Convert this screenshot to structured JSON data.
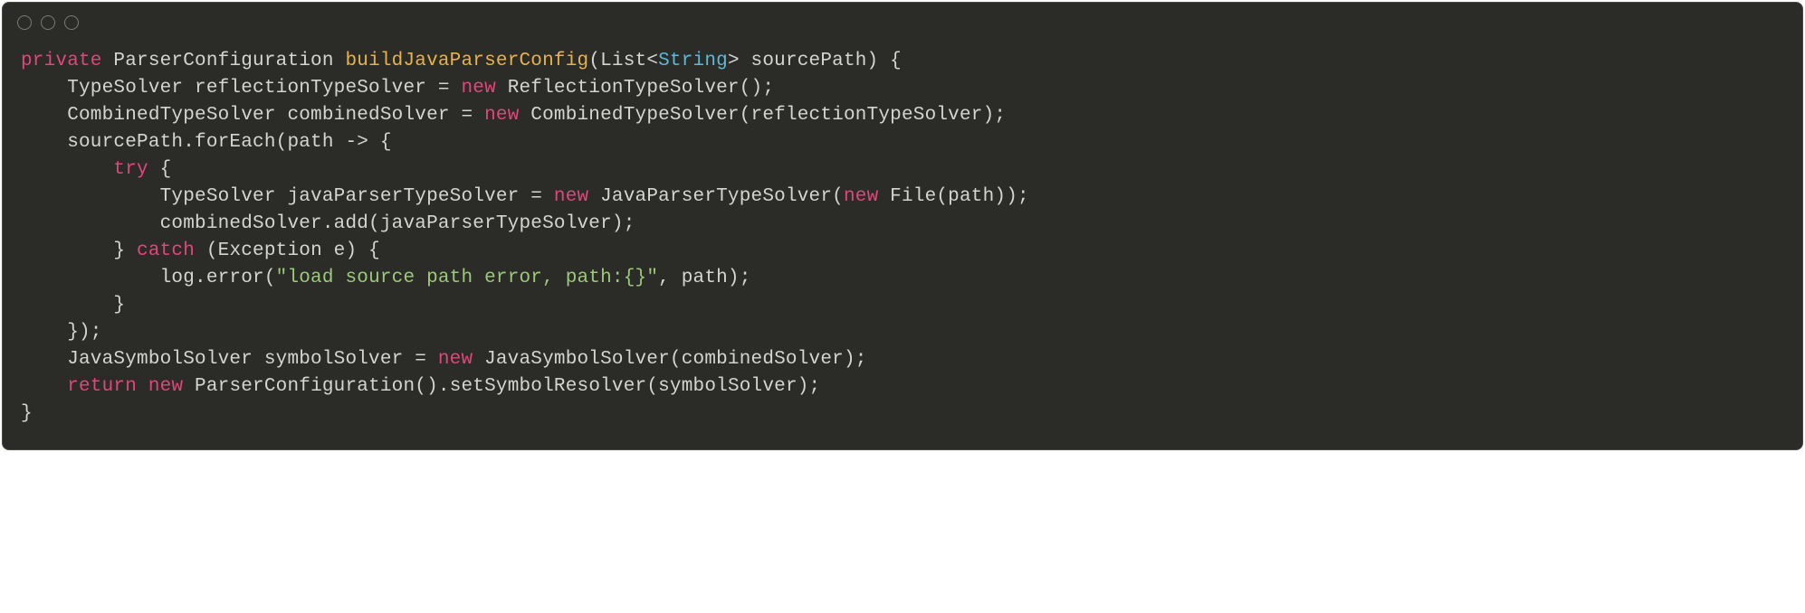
{
  "code": {
    "tokens": [
      [
        {
          "cls": "tok-keyword",
          "text": "private"
        },
        {
          "cls": "tok-plain",
          "text": " ParserConfiguration "
        },
        {
          "cls": "tok-method",
          "text": "buildJavaParserConfig"
        },
        {
          "cls": "tok-plain",
          "text": "(List<"
        },
        {
          "cls": "tok-builtin",
          "text": "String"
        },
        {
          "cls": "tok-plain",
          "text": "> sourcePath) {"
        }
      ],
      [
        {
          "cls": "tok-plain",
          "text": "    TypeSolver reflectionTypeSolver = "
        },
        {
          "cls": "tok-new",
          "text": "new"
        },
        {
          "cls": "tok-plain",
          "text": " ReflectionTypeSolver();"
        }
      ],
      [
        {
          "cls": "tok-plain",
          "text": "    CombinedTypeSolver combinedSolver = "
        },
        {
          "cls": "tok-new",
          "text": "new"
        },
        {
          "cls": "tok-plain",
          "text": " CombinedTypeSolver(reflectionTypeSolver);"
        }
      ],
      [
        {
          "cls": "tok-plain",
          "text": "    sourcePath.forEach(path -> {"
        }
      ],
      [
        {
          "cls": "tok-plain",
          "text": "        "
        },
        {
          "cls": "tok-keyword",
          "text": "try"
        },
        {
          "cls": "tok-plain",
          "text": " {"
        }
      ],
      [
        {
          "cls": "tok-plain",
          "text": "            TypeSolver javaParserTypeSolver = "
        },
        {
          "cls": "tok-new",
          "text": "new"
        },
        {
          "cls": "tok-plain",
          "text": " JavaParserTypeSolver("
        },
        {
          "cls": "tok-new",
          "text": "new"
        },
        {
          "cls": "tok-plain",
          "text": " File(path));"
        }
      ],
      [
        {
          "cls": "tok-plain",
          "text": "            combinedSolver.add(javaParserTypeSolver);"
        }
      ],
      [
        {
          "cls": "tok-plain",
          "text": "        } "
        },
        {
          "cls": "tok-keyword",
          "text": "catch"
        },
        {
          "cls": "tok-plain",
          "text": " (Exception e) {"
        }
      ],
      [
        {
          "cls": "tok-plain",
          "text": "            log.error("
        },
        {
          "cls": "tok-string",
          "text": "\"load source path error, path:{}\""
        },
        {
          "cls": "tok-plain",
          "text": ", path);"
        }
      ],
      [
        {
          "cls": "tok-plain",
          "text": "        }"
        }
      ],
      [
        {
          "cls": "tok-plain",
          "text": "    });"
        }
      ],
      [
        {
          "cls": "tok-plain",
          "text": "    JavaSymbolSolver symbolSolver = "
        },
        {
          "cls": "tok-new",
          "text": "new"
        },
        {
          "cls": "tok-plain",
          "text": " JavaSymbolSolver(combinedSolver);"
        }
      ],
      [
        {
          "cls": "tok-plain",
          "text": "    "
        },
        {
          "cls": "tok-keyword",
          "text": "return"
        },
        {
          "cls": "tok-plain",
          "text": " "
        },
        {
          "cls": "tok-new",
          "text": "new"
        },
        {
          "cls": "tok-plain",
          "text": " ParserConfiguration().setSymbolResolver(symbolSolver);"
        }
      ],
      [
        {
          "cls": "tok-plain",
          "text": "}"
        }
      ]
    ]
  }
}
